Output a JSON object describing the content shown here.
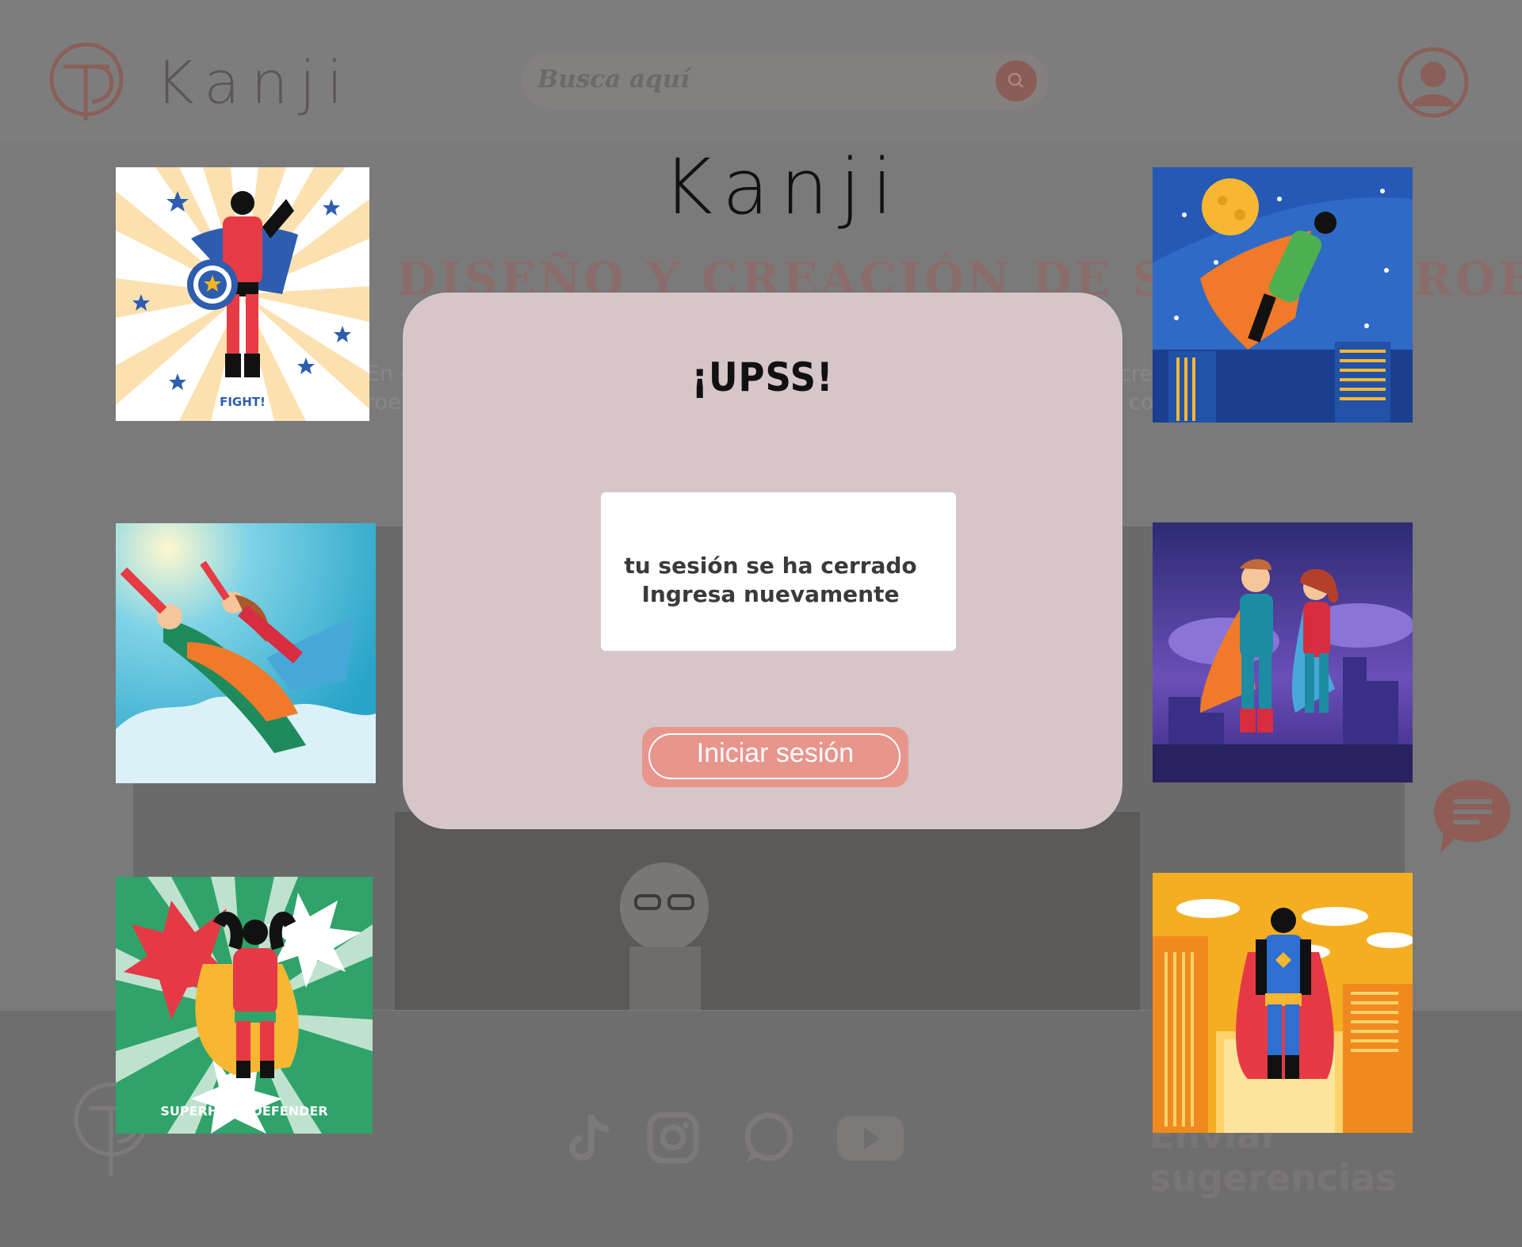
{
  "header": {
    "logo_text": "Kanji",
    "search_placeholder": "Busca aquí"
  },
  "main": {
    "heading": "DISEÑO Y CREACIÓN DE SUPERHÉROES",
    "text_fragments": [
      "En e",
      "roe",
      "crea",
      "co"
    ]
  },
  "footer": {
    "suggestions_label": "Enviar sugerencias",
    "social": [
      "tiktok-icon",
      "instagram-icon",
      "whatsapp-icon",
      "youtube-icon"
    ]
  },
  "tiles": {
    "tile1_caption": "FIGHT!",
    "tile5_caption": "SUPERHERO DEFENDER"
  },
  "modal": {
    "brand": "Kanji",
    "title": "¡UPSS!",
    "message_line1": "tu sesión se ha cerrado",
    "message_line2": "Ingresa nuevamente",
    "button_label": "Iniciar sesión"
  },
  "colors": {
    "modal_bg": "#d6c6ca",
    "button": "#e8958c",
    "overlay": "#7a7a7a"
  }
}
